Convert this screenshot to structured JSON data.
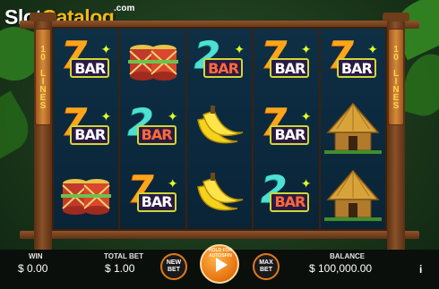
{
  "watermark": {
    "slot": "Slot",
    "catalog": "Catalog",
    "com": ".com"
  },
  "lines_label": "10 LINES",
  "symbols": {
    "bar_text": "BAR",
    "seven_digit": "7",
    "two_digit": "2"
  },
  "reels": [
    [
      "7bar",
      "7bar",
      "drum"
    ],
    [
      "drum",
      "2bar",
      "7bar"
    ],
    [
      "2bar",
      "banana",
      "banana"
    ],
    [
      "7bar",
      "7bar",
      "2bar"
    ],
    [
      "7bar",
      "hut",
      "hut"
    ]
  ],
  "bottom_bar": {
    "win_label": "WIN",
    "win_value": "$ 0.00",
    "total_bet_label": "TOTAL BET",
    "total_bet_value": "$ 1.00",
    "new_bet_label": "NEW BET",
    "spin_hint": "HOLD FOR AUTOSPIN",
    "max_bet_label": "MAX BET",
    "balance_label": "BALANCE",
    "balance_value": "$ 100,000.00",
    "info_label": "i"
  },
  "colors": {
    "accent": "#e87612",
    "frame": "#8a5228",
    "reel_bg": "#0d2a3e",
    "seven": "#ffa51a",
    "two": "#4de0d4"
  }
}
